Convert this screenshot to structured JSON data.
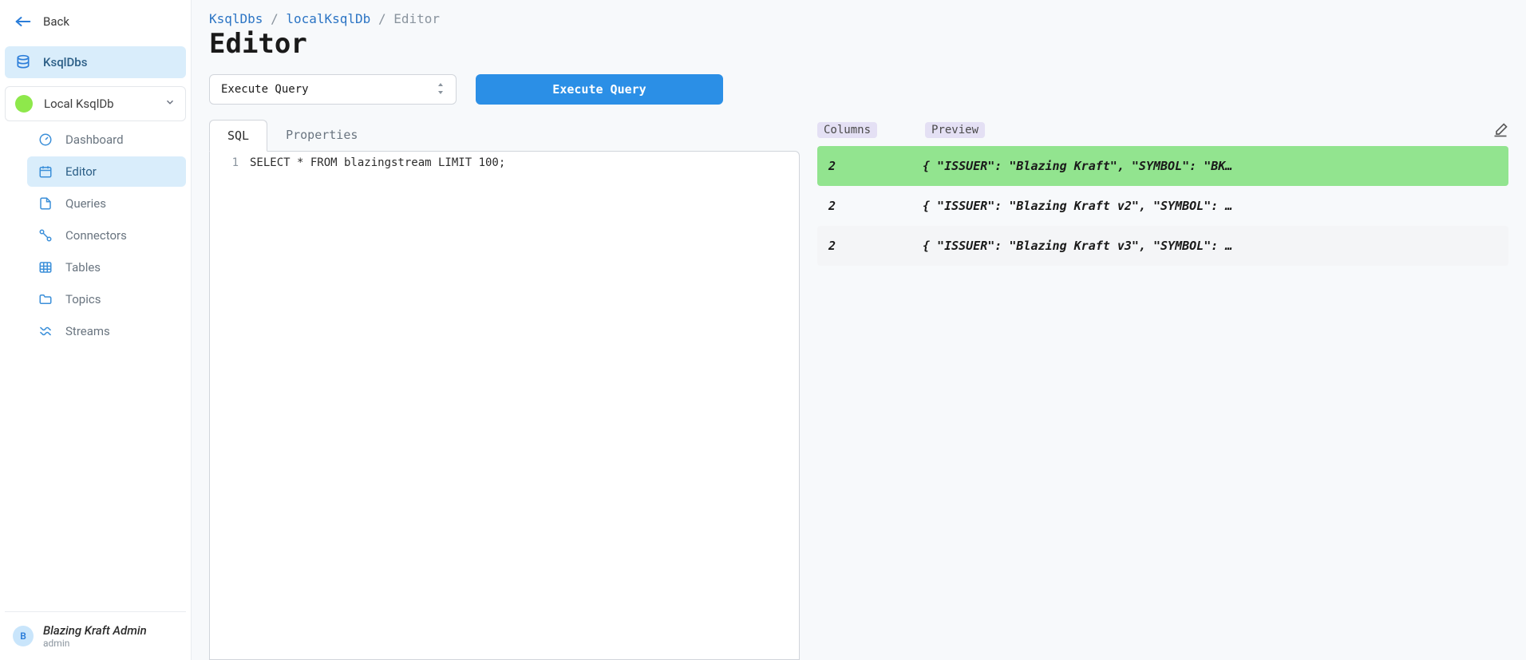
{
  "sidebar": {
    "back_label": "Back",
    "group_label": "KsqlDbs",
    "connection_label": "Local KsqlDb",
    "items": [
      {
        "label": "Dashboard"
      },
      {
        "label": "Editor"
      },
      {
        "label": "Queries"
      },
      {
        "label": "Connectors"
      },
      {
        "label": "Tables"
      },
      {
        "label": "Topics"
      },
      {
        "label": "Streams"
      }
    ],
    "user_name": "Blazing Kraft Admin",
    "user_role": "admin",
    "avatar_letter": "B"
  },
  "breadcrumb": {
    "part1": "KsqlDbs",
    "part2": "localKsqlDb",
    "part3": "Editor"
  },
  "page_title": "Editor",
  "action": {
    "select_value": "Execute Query",
    "button_label": "Execute Query"
  },
  "tabs": {
    "sql": "SQL",
    "properties": "Properties"
  },
  "code": {
    "line_number": "1",
    "line_text": "SELECT * FROM blazingstream LIMIT 100;"
  },
  "results": {
    "columns_label": "Columns",
    "preview_label": "Preview",
    "rows": [
      {
        "count": "2",
        "preview": "{ \"ISSUER\": \"Blazing Kraft\", \"SYMBOL\": \"BK…"
      },
      {
        "count": "2",
        "preview": "{ \"ISSUER\": \"Blazing Kraft v2\", \"SYMBOL\": …"
      },
      {
        "count": "2",
        "preview": "{ \"ISSUER\": \"Blazing Kraft v3\", \"SYMBOL\": …"
      }
    ]
  }
}
